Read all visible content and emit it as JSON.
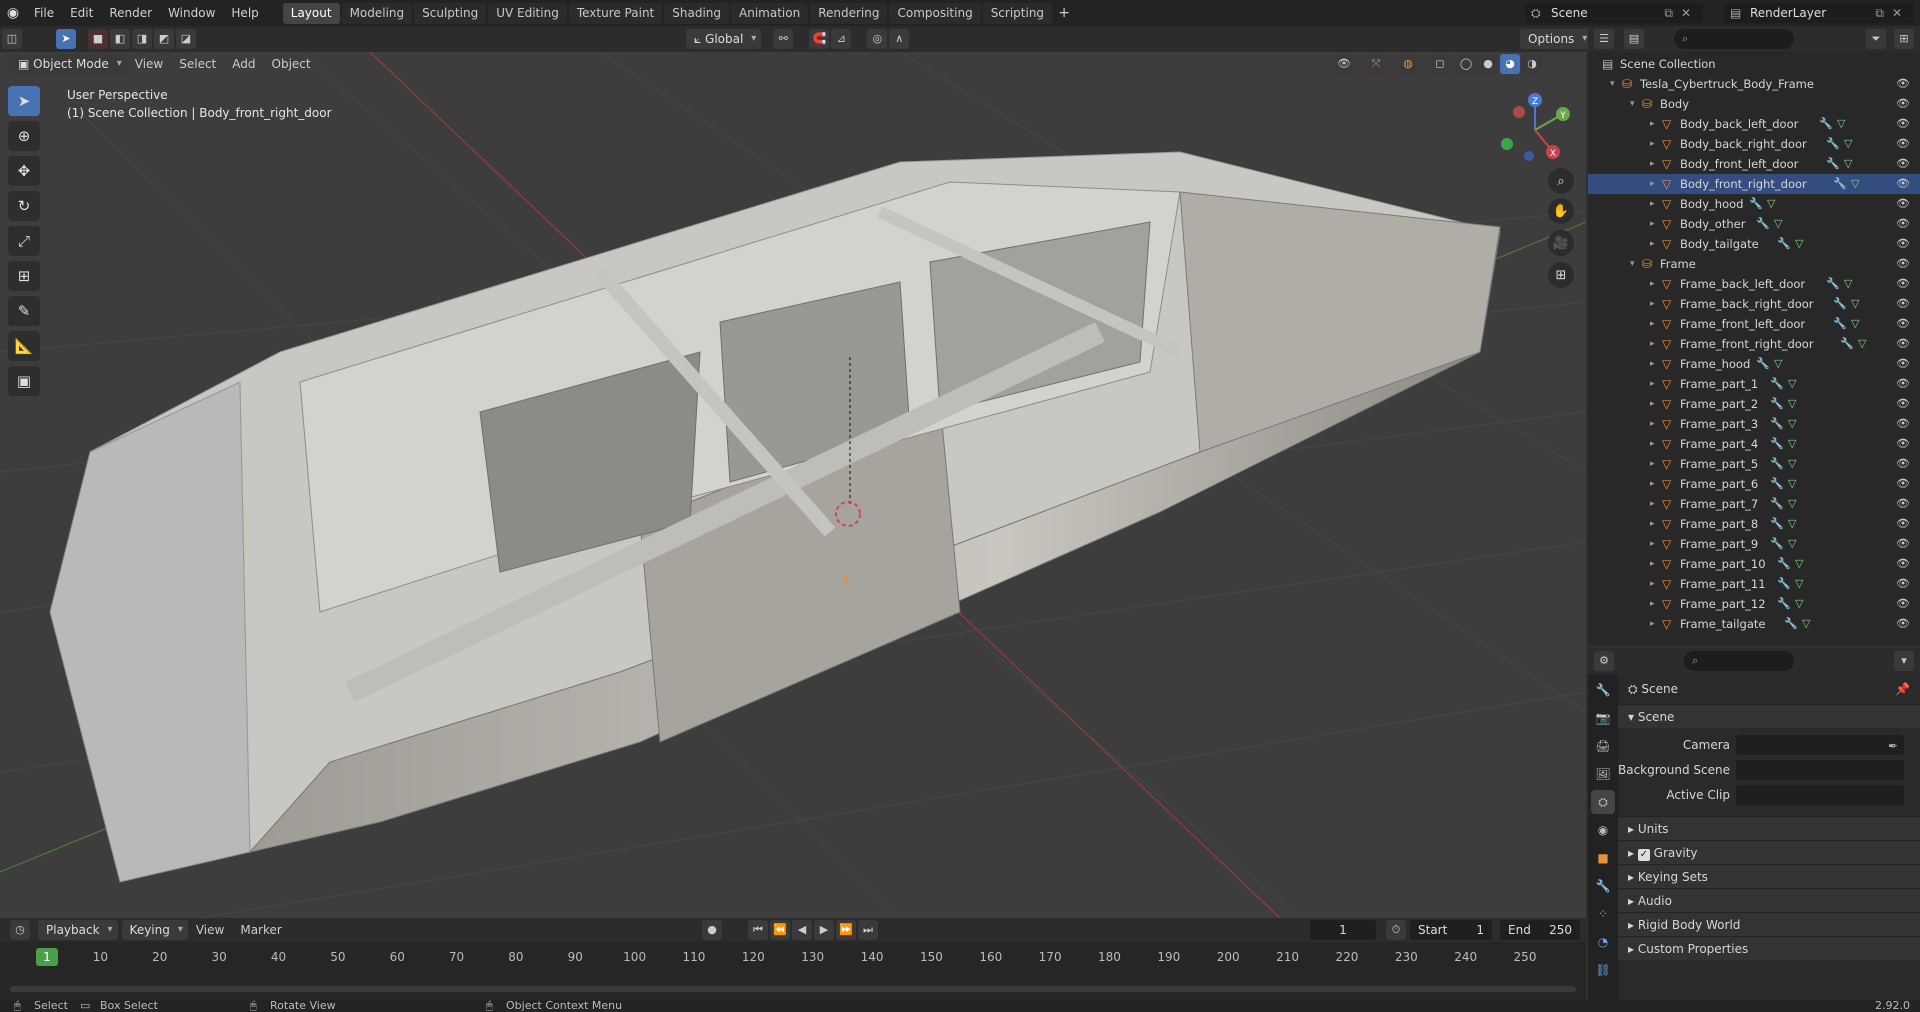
{
  "topbar": {
    "menus": [
      "File",
      "Edit",
      "Render",
      "Window",
      "Help"
    ],
    "workspaces": [
      "Layout",
      "Modeling",
      "Sculpting",
      "UV Editing",
      "Texture Paint",
      "Shading",
      "Animation",
      "Rendering",
      "Compositing",
      "Scripting"
    ],
    "active_workspace": "Layout",
    "add_label": "+",
    "scene_name": "Scene",
    "view_layer": "RenderLayer"
  },
  "viewport_header": {
    "transform_orientation": "Global",
    "options_label": "Options"
  },
  "viewport_header2": {
    "mode": "Object Mode",
    "menus": [
      "View",
      "Select",
      "Add",
      "Object"
    ]
  },
  "viewport": {
    "perspective": "User Perspective",
    "context": "(1) Scene Collection | Body_front_right_door",
    "gizmo": {
      "x": "X",
      "y": "Y",
      "z": "Z"
    }
  },
  "outliner": {
    "root": "Scene Collection",
    "collection": "Tesla_Cybertruck_Body_Frame",
    "groups": [
      {
        "name": "Body",
        "children": [
          "Body_back_left_door",
          "Body_back_right_door",
          "Body_front_left_door",
          "Body_front_right_door",
          "Body_hood",
          "Body_other",
          "Body_tailgate"
        ]
      },
      {
        "name": "Frame",
        "children": [
          "Frame_back_left_door",
          "Frame_back_right_door",
          "Frame_front_left_door",
          "Frame_front_right_door",
          "Frame_hood",
          "Frame_part_1",
          "Frame_part_2",
          "Frame_part_3",
          "Frame_part_4",
          "Frame_part_5",
          "Frame_part_6",
          "Frame_part_7",
          "Frame_part_8",
          "Frame_part_9",
          "Frame_part_10",
          "Frame_part_11",
          "Frame_part_12",
          "Frame_tailgate"
        ]
      }
    ],
    "selected": "Body_front_right_door"
  },
  "properties": {
    "context": "Scene",
    "panel": "Scene",
    "fields": [
      {
        "label": "Camera"
      },
      {
        "label": "Background Scene"
      },
      {
        "label": "Active Clip"
      }
    ],
    "subpanels": [
      "Units",
      "Gravity",
      "Keying Sets",
      "Audio",
      "Rigid Body World",
      "Custom Properties"
    ],
    "gravity_checked": true
  },
  "timeline": {
    "menus": [
      "Playback",
      "Keying",
      "View",
      "Marker"
    ],
    "current_frame": "1",
    "start_label": "Start",
    "start": "1",
    "end_label": "End",
    "end": "250",
    "ticks": [
      "10",
      "20",
      "30",
      "40",
      "50",
      "60",
      "70",
      "80",
      "90",
      "100",
      "110",
      "120",
      "130",
      "140",
      "150",
      "160",
      "170",
      "180",
      "190",
      "200",
      "210",
      "220",
      "230",
      "240",
      "250"
    ],
    "playhead": "1"
  },
  "statusbar": {
    "select": "Select",
    "box_select": "Box Select",
    "rotate": "Rotate View",
    "context_menu": "Object Context Menu",
    "version": "2.92.0"
  },
  "colors": {
    "accent": "#4772b3",
    "active_tool": "#4772b3",
    "selection": "#334d80",
    "mesh_icon": "#e8913a",
    "collection_icon": "#e8913a",
    "playhead": "#4aa04a"
  }
}
